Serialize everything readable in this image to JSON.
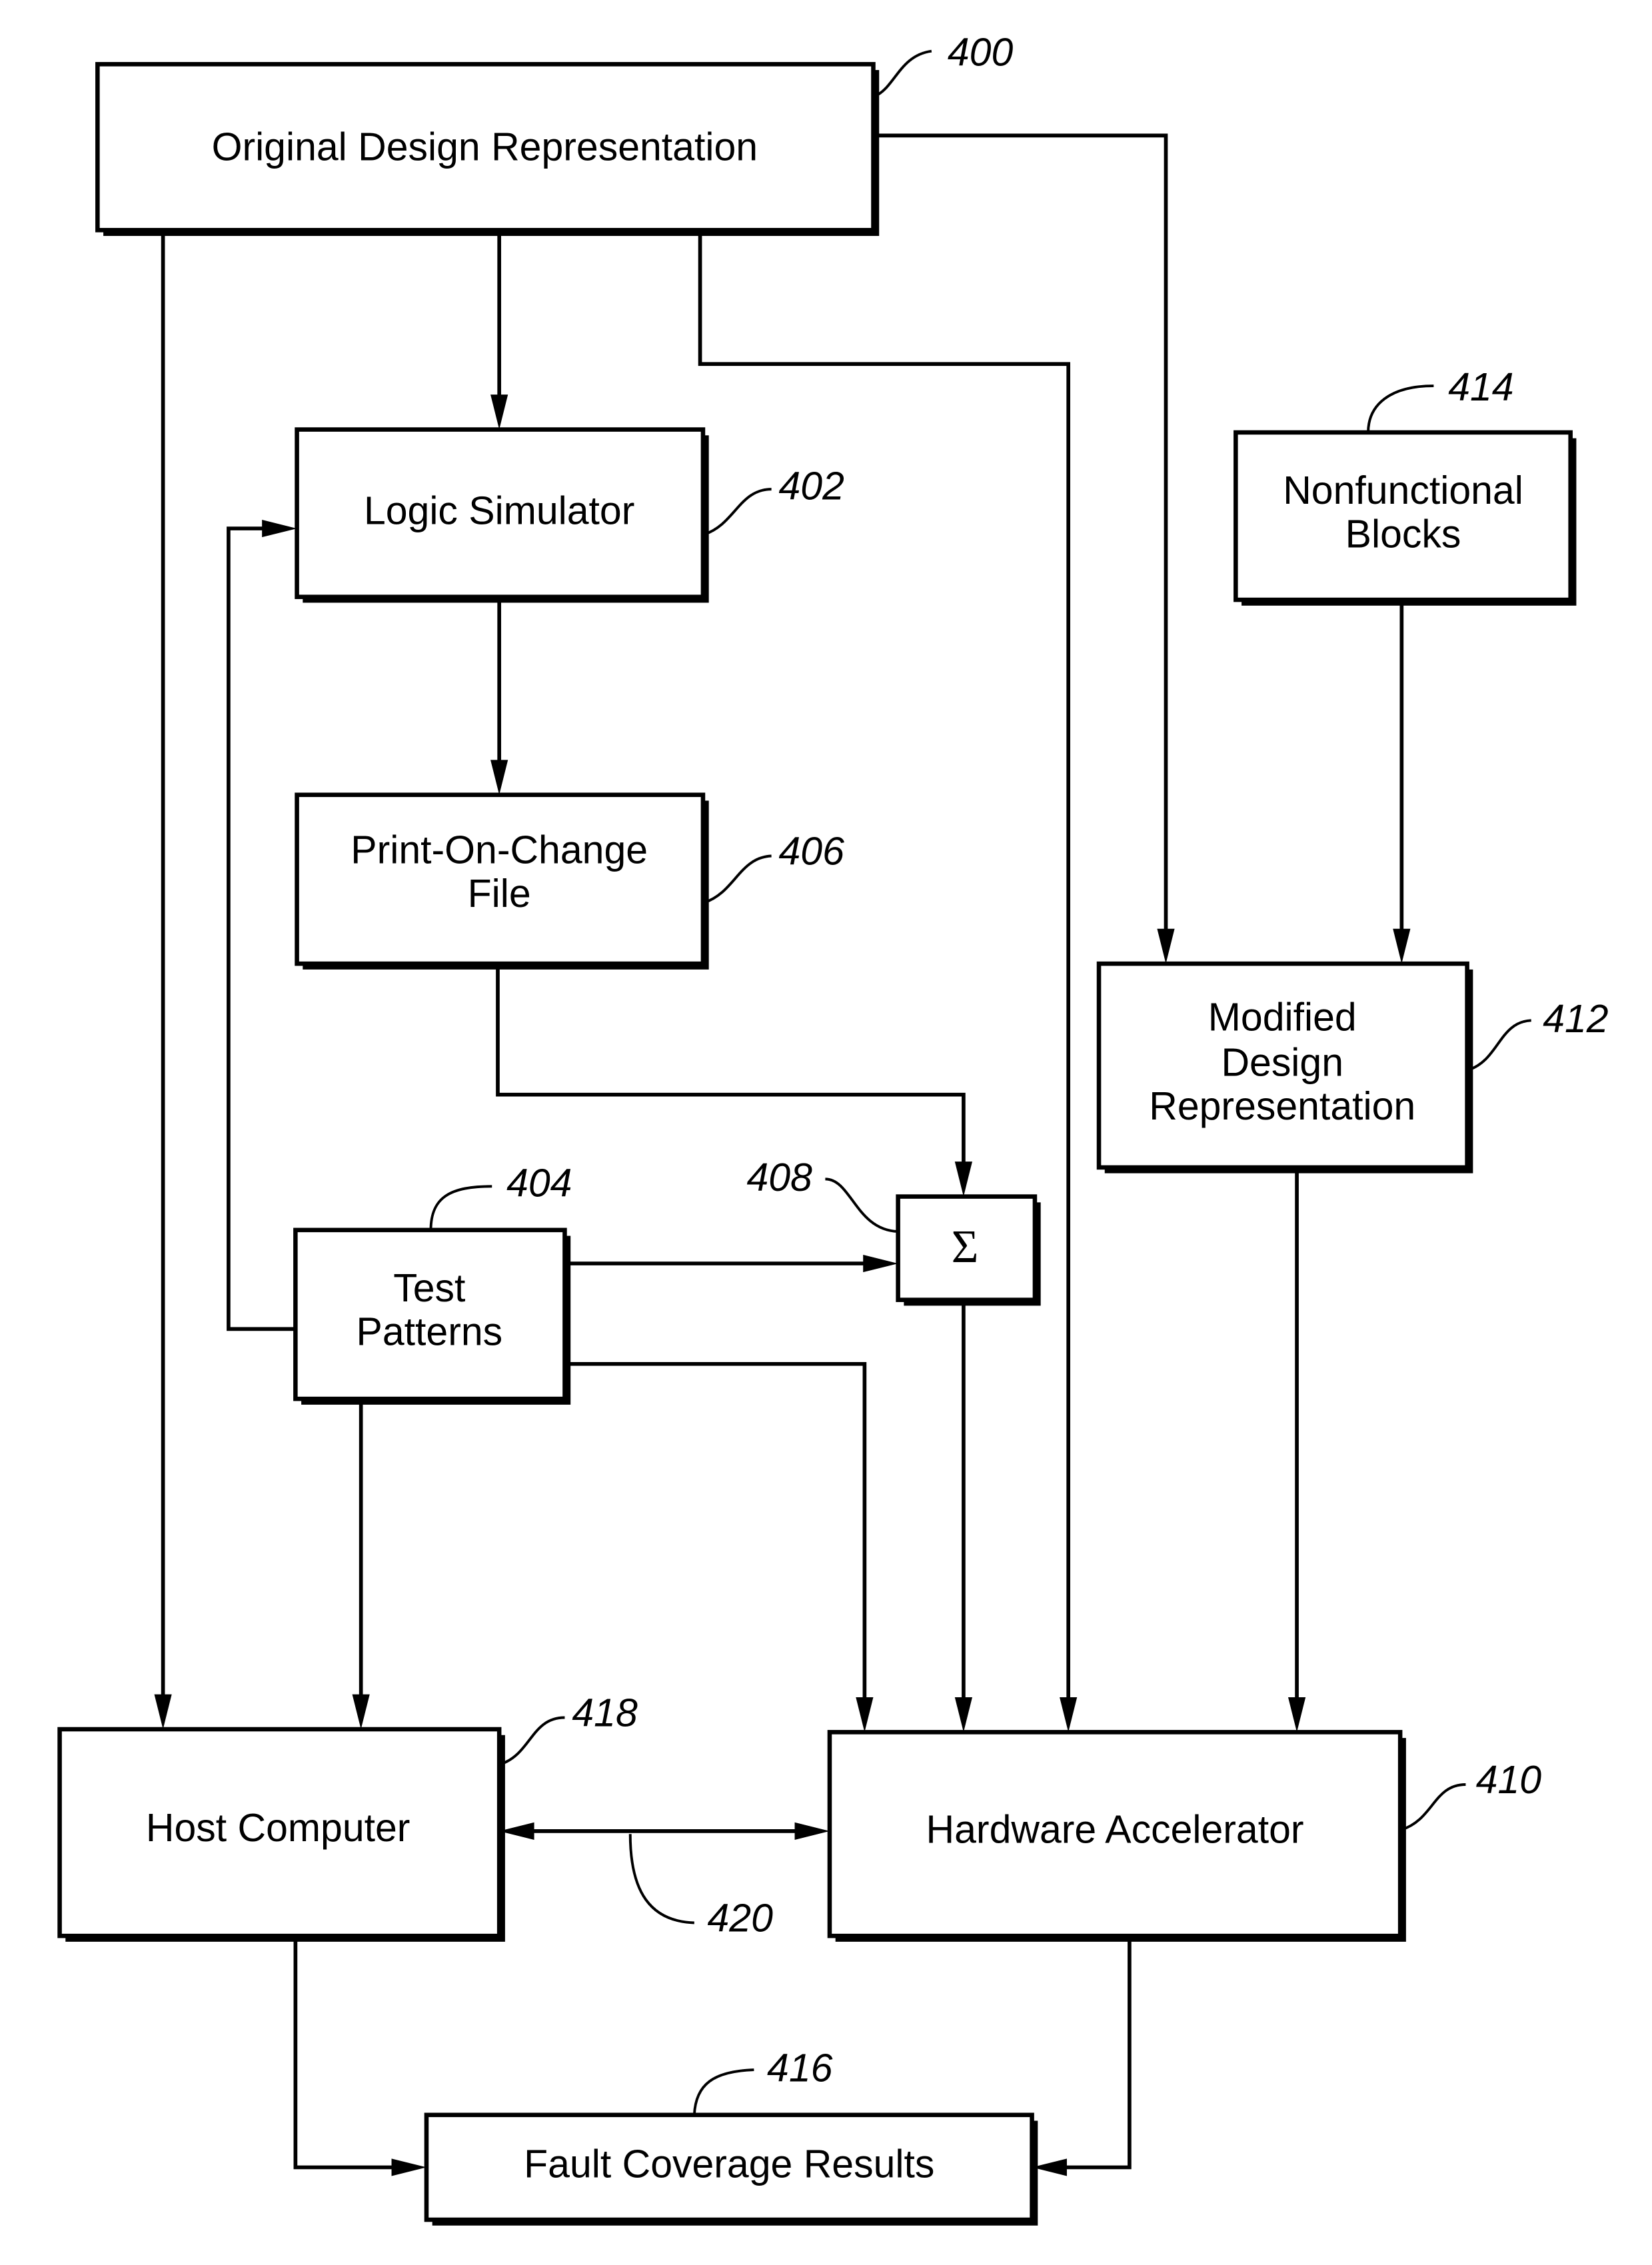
{
  "figure": {
    "type": "block-diagram",
    "description": "Fault coverage flow: design representation, logic simulation, hardware acceleration"
  },
  "blocks": {
    "original_design": {
      "ref": "400",
      "lines": [
        "Original Design Representation"
      ]
    },
    "logic_simulator": {
      "ref": "402",
      "lines": [
        "Logic Simulator"
      ]
    },
    "test_patterns": {
      "ref": "404",
      "lines": [
        "Test",
        "Patterns"
      ]
    },
    "print_on_change": {
      "ref": "406",
      "lines": [
        "Print-On-Change",
        "File"
      ]
    },
    "summer": {
      "ref": "408",
      "lines": [
        "Σ"
      ]
    },
    "hardware_accelerator": {
      "ref": "410",
      "lines": [
        "Hardware Accelerator"
      ]
    },
    "modified_design": {
      "ref": "412",
      "lines": [
        "Modified",
        "Design",
        "Representation"
      ]
    },
    "nonfunctional_blocks": {
      "ref": "414",
      "lines": [
        "Nonfunctional",
        "Blocks"
      ]
    },
    "fault_coverage": {
      "ref": "416",
      "lines": [
        "Fault Coverage Results"
      ]
    },
    "host_computer": {
      "ref": "418",
      "lines": [
        "Host Computer"
      ]
    }
  },
  "link_refs": {
    "host_accelerator_link": "420"
  },
  "connections": [
    {
      "from": "original_design",
      "to": "logic_simulator"
    },
    {
      "from": "original_design",
      "to": "host_computer"
    },
    {
      "from": "original_design",
      "to": "hardware_accelerator"
    },
    {
      "from": "original_design",
      "to": "modified_design"
    },
    {
      "from": "logic_simulator",
      "to": "print_on_change"
    },
    {
      "from": "print_on_change",
      "to": "summer"
    },
    {
      "from": "test_patterns",
      "to": "summer"
    },
    {
      "from": "test_patterns",
      "to": "logic_simulator"
    },
    {
      "from": "test_patterns",
      "to": "host_computer"
    },
    {
      "from": "test_patterns",
      "to": "hardware_accelerator"
    },
    {
      "from": "summer",
      "to": "hardware_accelerator"
    },
    {
      "from": "nonfunctional_blocks",
      "to": "modified_design"
    },
    {
      "from": "modified_design",
      "to": "hardware_accelerator"
    },
    {
      "from": "host_computer",
      "to": "hardware_accelerator",
      "bidirectional": true,
      "ref": "420"
    },
    {
      "from": "host_computer",
      "to": "fault_coverage"
    },
    {
      "from": "hardware_accelerator",
      "to": "fault_coverage"
    }
  ]
}
